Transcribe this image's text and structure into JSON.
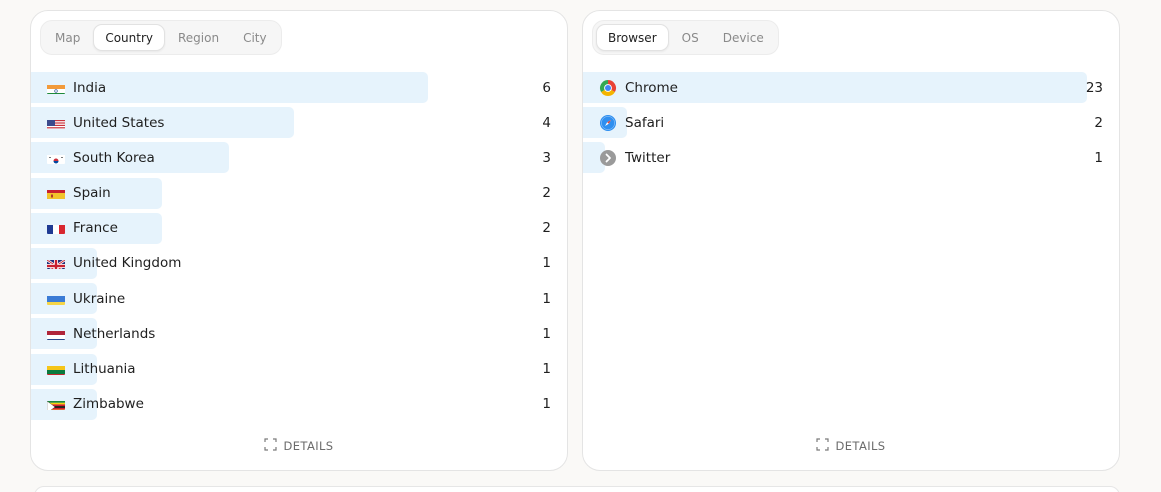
{
  "location_card": {
    "tabs": [
      {
        "label": "Map",
        "active": false
      },
      {
        "label": "Country",
        "active": true
      },
      {
        "label": "Region",
        "active": false
      },
      {
        "label": "City",
        "active": false
      }
    ],
    "rows": [
      {
        "label": "India",
        "value": "6",
        "flag": "india-flag-icon"
      },
      {
        "label": "United States",
        "value": "4",
        "flag": "united-states-flag-icon"
      },
      {
        "label": "South Korea",
        "value": "3",
        "flag": "south-korea-flag-icon"
      },
      {
        "label": "Spain",
        "value": "2",
        "flag": "spain-flag-icon"
      },
      {
        "label": "France",
        "value": "2",
        "flag": "france-flag-icon"
      },
      {
        "label": "United Kingdom",
        "value": "1",
        "flag": "united-kingdom-flag-icon"
      },
      {
        "label": "Ukraine",
        "value": "1",
        "flag": "ukraine-flag-icon"
      },
      {
        "label": "Netherlands",
        "value": "1",
        "flag": "netherlands-flag-icon"
      },
      {
        "label": "Lithuania",
        "value": "1",
        "flag": "lithuania-flag-icon"
      },
      {
        "label": "Zimbabwe",
        "value": "1",
        "flag": "zimbabwe-flag-icon"
      }
    ],
    "bar_fractions": [
      0.74,
      0.49,
      0.37,
      0.245,
      0.245,
      0.123,
      0.123,
      0.123,
      0.123,
      0.123
    ],
    "details_label": "DETAILS"
  },
  "device_card": {
    "tabs": [
      {
        "label": "Browser",
        "active": true
      },
      {
        "label": "OS",
        "active": false
      },
      {
        "label": "Device",
        "active": false
      }
    ],
    "rows": [
      {
        "label": "Chrome",
        "value": "23",
        "icon": "chrome-icon"
      },
      {
        "label": "Safari",
        "value": "2",
        "icon": "safari-icon"
      },
      {
        "label": "Twitter",
        "value": "1",
        "icon": "twitter-link-icon"
      }
    ],
    "bar_fractions": [
      0.94,
      0.082,
      0.041
    ],
    "details_label": "DETAILS"
  },
  "colors": {
    "bar": "#e6f3fc",
    "background": "#faf9f7"
  }
}
